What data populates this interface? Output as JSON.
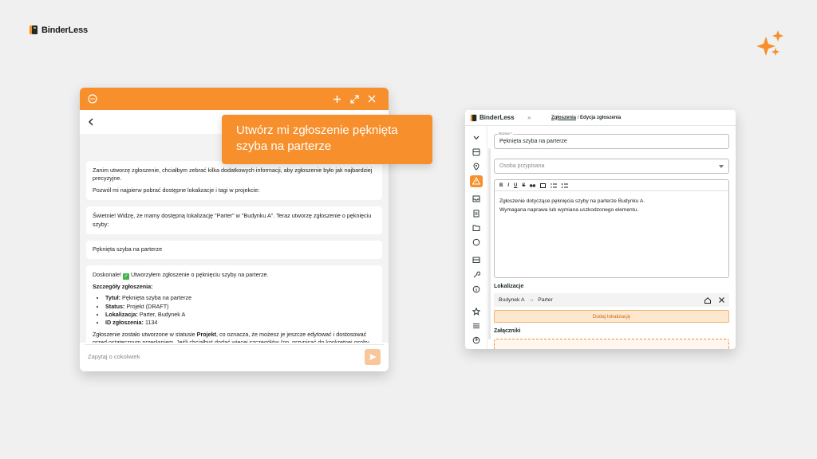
{
  "brand": {
    "name": "BinderLess"
  },
  "colors": {
    "accent": "#f68f2c",
    "accent_light": "#fde7cf",
    "text": "#1e2b26",
    "background": "#f0f0f1"
  },
  "chat": {
    "header_icons": [
      "chat-icon",
      "plus-icon",
      "expand-icon",
      "close-icon"
    ],
    "back_icon": "‹",
    "bubble": "Utwórz mi zgłoszenie pęknięta szyba na parterze",
    "messages": {
      "m1_p1": "Zanim utworzę zgłoszenie, chciałbym zebrać kilka dodatkowych informacji, aby zgłoszenie było jak najbardziej precyzyjne.",
      "m1_p2": "Pozwól mi najpierw pobrać dostępne lokalizacje i tagi w projekcie:",
      "m2": "Świetnie! Widzę, że mamy dostępną lokalizację \"Parter\" w \"Budynku A\". Teraz utworzę zgłoszenie o pęknięciu szyby:",
      "m3": "Pęknięta szyba na parterze",
      "m4_intro_a": "Doskonale!",
      "m4_intro_b": "Utworzyłem zgłoszenie o pęknięciu szyby na parterze.",
      "m4_details_title": "Szczegóły zgłoszenia:",
      "m4_items": [
        {
          "k": "Tytuł:",
          "v": "Pęknięta szyba na parterze"
        },
        {
          "k": "Status:",
          "v": "Projekt (DRAFT)"
        },
        {
          "k": "Lokalizacja:",
          "v": "Parter, Budynek A"
        },
        {
          "k": "ID zgłoszenia:",
          "v": "1134"
        }
      ],
      "m4_end_a": "Zgłoszenie zostało utworzone w statusie",
      "m4_end_b": "Projekt",
      "m4_end_c": ", co oznacza, że możesz je jeszcze edytować i dostosować przed ostatecznym przesłaniem. Jeśli chciałbyś dodać więcej szczegółów (np. przypisać do konkretnej osoby, dodać tagi, czy rozszerzyć opis), daj mi znać!"
    },
    "input_placeholder": "Zapytaj o cokolwiek"
  },
  "app": {
    "logo": "BinderLess",
    "breadcrumb_root": "Zgłoszenia",
    "breadcrumb_sep": "/",
    "breadcrumb_current": "Edycja zgłoszenia",
    "name_label": "Nazwa *",
    "name_value": "Pęknięta szyba na parterze",
    "assignee_placeholder": "Osoba przypisana",
    "toolbar": [
      "B",
      "I",
      "U",
      "S"
    ],
    "description_line1": "Zgłoszenie dotyczące pęknięcia szyby na parterze Budynku A.",
    "description_line2": "Wymagana naprawa lub wymiana uszkodzonego elementu.",
    "locations_label": "Lokalizacje",
    "location_building": "Budynek A",
    "location_floor": "Parter",
    "add_location": "Dodaj lokalizację",
    "attachments_label": "Załączniki"
  }
}
